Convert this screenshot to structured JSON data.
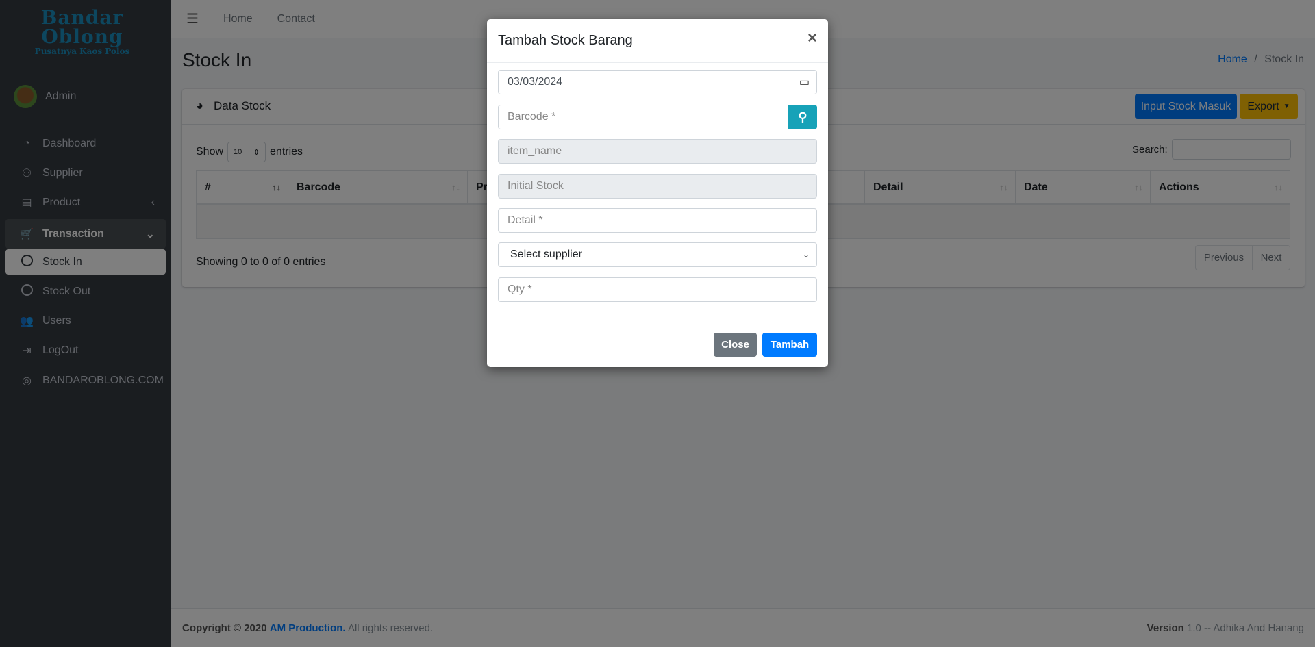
{
  "sidebar": {
    "logo": {
      "line1": "Bandar",
      "line2": "Oblong",
      "tagline": "Pusatnya Kaos Polos"
    },
    "user": "Admin",
    "items": [
      {
        "label": "Dashboard",
        "icon": "tachometer-icon"
      },
      {
        "label": "Supplier",
        "icon": "people-carry-icon"
      },
      {
        "label": "Product",
        "icon": "store-icon",
        "chevron": "‹"
      },
      {
        "label": "Transaction",
        "icon": "cart-icon",
        "chevron": "⌄"
      },
      {
        "label": "Stock In",
        "icon": "circle-icon"
      },
      {
        "label": "Stock Out",
        "icon": "circle-icon"
      },
      {
        "label": "Users",
        "icon": "users-icon"
      },
      {
        "label": "LogOut",
        "icon": "sign-out-icon"
      },
      {
        "label": "BANDAROBLONG.COM",
        "icon": "chrome-icon"
      }
    ]
  },
  "topnav": {
    "menu_icon": "☰",
    "links": [
      "Home",
      "Contact"
    ]
  },
  "page": {
    "title": "Stock In",
    "breadcrumb": {
      "home": "Home",
      "sep": "/",
      "current": "Stock In"
    }
  },
  "card": {
    "title": "Data Stock",
    "input_button": "Input Stock Masuk",
    "export_button": "Export",
    "show": "Show",
    "entries_value": "10",
    "entries": "entries",
    "search_label": "Search:",
    "columns": [
      "#",
      "Barcode",
      "Product",
      "Detail",
      "Date",
      "Actions"
    ],
    "info": "Showing 0 to 0 of 0 entries",
    "prev": "Previous",
    "next": "Next"
  },
  "footer": {
    "copyright": "Copyright © 2020",
    "company": "AM Production.",
    "rights": "All rights reserved.",
    "version_label": "Version",
    "version": "1.0 -- Adhika And Hanang"
  },
  "modal": {
    "title": "Tambah Stock Barang",
    "close_x": "×",
    "date": "03/03/2024",
    "barcode_placeholder": "Barcode *",
    "item_name_placeholder": "item_name",
    "initial_stock_placeholder": "Initial Stock",
    "detail_placeholder": "Detail *",
    "supplier_selected": "Select supplier",
    "qty_placeholder": "Qty *",
    "close_button": "Close",
    "submit_button": "Tambah"
  },
  "colors": {
    "primary": "#007bff",
    "info": "#17a2b8",
    "warning": "#ffc107",
    "secondary": "#6c757d",
    "sidebar": "#343a40"
  }
}
